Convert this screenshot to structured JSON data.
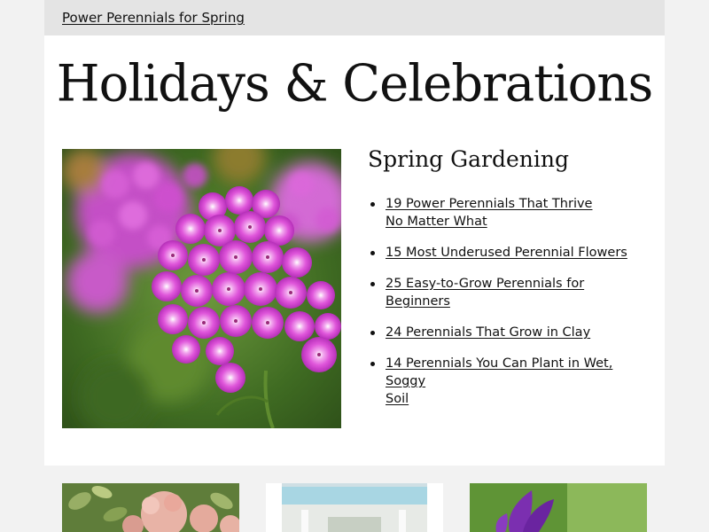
{
  "topbar": {
    "link_label": "Power Perennials for Spring"
  },
  "hero": {
    "title": "Holidays & Celebrations"
  },
  "feature": {
    "image_alt": "pink phlox flowers",
    "section_title": "Spring Gardening",
    "links": [
      {
        "line1": "19 Power Perennials That Thrive",
        "line2": "No Matter What"
      },
      {
        "line1": "15 Most Underused Perennial Flowers",
        "line2": ""
      },
      {
        "line1": "25 Easy-to-Grow Perennials for Beginners",
        "line2": ""
      },
      {
        "line1": "24 Perennials That Grow in Clay",
        "line2": ""
      },
      {
        "line1": "14 Perennials You Can Plant in Wet, Soggy",
        "line2": "Soil"
      }
    ]
  },
  "colors": {
    "page_bg": "#ffffff",
    "outer_bg": "#f2f2f2",
    "topbar_bg": "#e4e4e4",
    "flower_magenta": "#d64fd8",
    "foliage_green": "#4f7a2e"
  },
  "thumbnails": [
    {
      "name": "hydrangea-thumbnail"
    },
    {
      "name": "porch-thumbnail"
    },
    {
      "name": "purple-flower-thumbnail"
    }
  ]
}
